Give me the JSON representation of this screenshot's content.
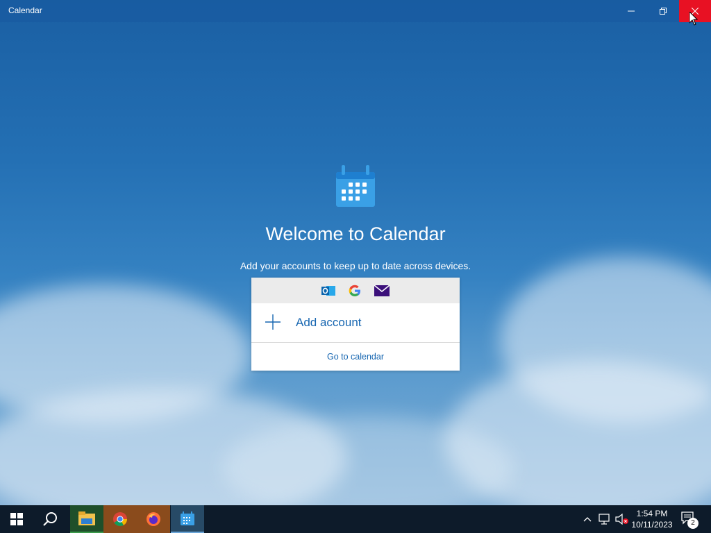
{
  "window": {
    "title": "Calendar",
    "minimize_icon": "minimize-icon",
    "restore_icon": "restore-icon",
    "close_icon": "close-icon"
  },
  "welcome": {
    "heading": "Welcome to Calendar",
    "subtitle": "Add your accounts to keep up to date across devices.",
    "providers": [
      "outlook-icon",
      "google-icon",
      "mail-icon"
    ],
    "add_account": "Add account",
    "go_to_calendar": "Go to calendar"
  },
  "colors": {
    "accent": "#1565b0",
    "close_hover": "#e81123",
    "taskbar": "#0d1b2a"
  },
  "taskbar": {
    "apps": [
      {
        "name": "start-icon"
      },
      {
        "name": "search-icon"
      },
      {
        "name": "file-explorer-icon"
      },
      {
        "name": "chrome-icon"
      },
      {
        "name": "firefox-icon"
      },
      {
        "name": "calendar-icon"
      }
    ],
    "time": "1:54 PM",
    "date": "10/11/2023",
    "notification_count": "2"
  }
}
